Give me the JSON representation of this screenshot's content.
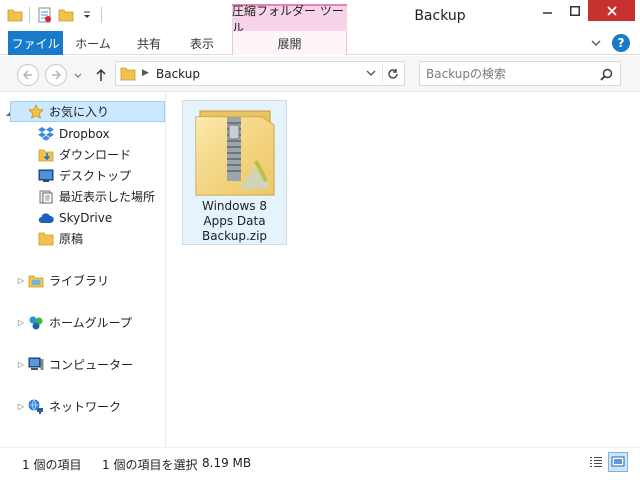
{
  "window": {
    "title": "Backup",
    "context_tab_group": "圧縮フォルダー ツール"
  },
  "ribbon": {
    "tabs": {
      "file": "ファイル",
      "home": "ホーム",
      "share": "共有",
      "view": "表示",
      "extract": "展開"
    }
  },
  "address": {
    "path": "Backup",
    "search_placeholder": "Backupの検索"
  },
  "nav_pane": {
    "favorites": "お気に入り",
    "favorite_items": [
      "Dropbox",
      "ダウンロード",
      "デスクトップ",
      "最近表示した場所",
      "SkyDrive",
      "原稿"
    ],
    "libraries": "ライブラリ",
    "homegroup": "ホームグループ",
    "computer": "コンピューター",
    "network": "ネットワーク"
  },
  "files": [
    {
      "name": "Windows 8\nApps Data\nBackup.zip",
      "type": "zip",
      "selected": true
    }
  ],
  "status": {
    "item_count": "1 個の項目",
    "selected_count": "1 個の項目を選択",
    "selected_size": "8.19 MB"
  },
  "colors": {
    "file_tab": "#1979ca",
    "close_button": "#c7312f",
    "context_tab": "#f7d3e9",
    "selection": "#cce8ff"
  }
}
